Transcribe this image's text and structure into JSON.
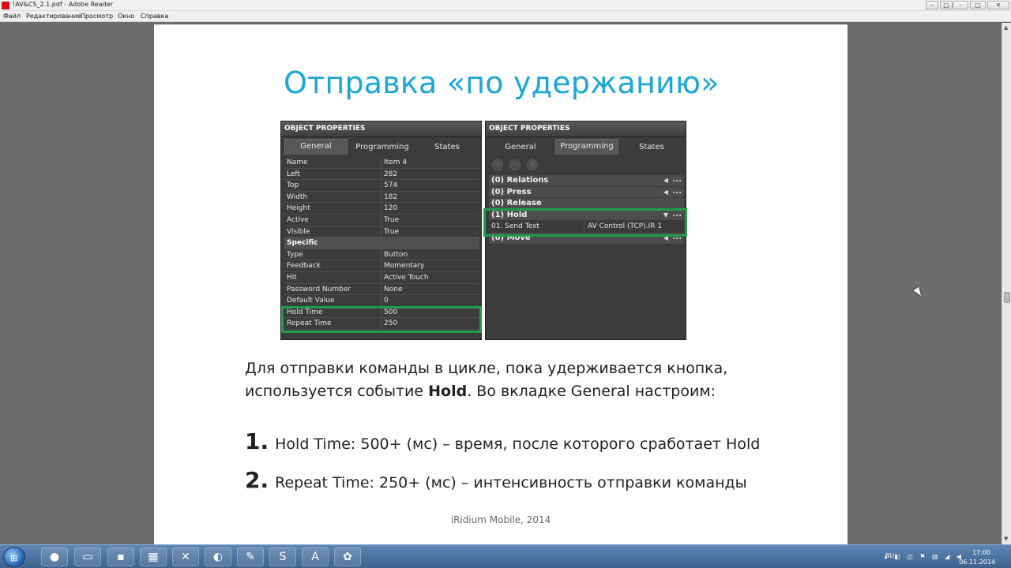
{
  "window": {
    "title": "!AV&CS_2.1.pdf - Adobe Reader",
    "minimize": "–",
    "maximize": "□",
    "close": "✕"
  },
  "menu": [
    "Файл",
    "Редактирование",
    "Просмотр",
    "Окно",
    "Справка"
  ],
  "slide": {
    "title": "Отправка «по удержанию»",
    "left_panel": {
      "header": "OBJECT PROPERTIES",
      "tabs": [
        "General",
        "Programming",
        "States"
      ],
      "active_tab": "General",
      "rows": [
        {
          "k": "Name",
          "v": "Item 4"
        },
        {
          "k": "Left",
          "v": "282"
        },
        {
          "k": "Top",
          "v": "574"
        },
        {
          "k": "Width",
          "v": "182"
        },
        {
          "k": "Height",
          "v": "120"
        },
        {
          "k": "Active",
          "v": "True"
        },
        {
          "k": "Visible",
          "v": "True"
        },
        {
          "k": "Specific",
          "v": ""
        },
        {
          "k": "Type",
          "v": "Button"
        },
        {
          "k": "Feedback",
          "v": "Momentary"
        },
        {
          "k": "Hit",
          "v": "Active Touch"
        },
        {
          "k": "Password Number",
          "v": "None"
        },
        {
          "k": "Default Value",
          "v": "0"
        },
        {
          "k": "Hold Time",
          "v": "500"
        },
        {
          "k": "Repeat Time",
          "v": "250"
        }
      ]
    },
    "right_panel": {
      "header": "OBJECT PROPERTIES",
      "tabs": [
        "General",
        "Programming",
        "States"
      ],
      "active_tab": "Programming",
      "events": {
        "relations": "(0) Relations",
        "press": "(0) Press",
        "release": "(0) Release",
        "hold": "(1) Hold",
        "move": "(0) Move"
      },
      "command": {
        "k": "01. Send Text",
        "v": "AV Control (TCP).IR 1"
      },
      "dots": "...",
      "arrow": "◀"
    },
    "paragraph_part1": "Для отправки команды в цикле, пока удерживается кнопка, используется  событие ",
    "paragraph_bold": "Hold",
    "paragraph_part2": ". Во вкладке General настроим:",
    "list": [
      {
        "num": "1.",
        "text": "Hold Time: 500+ (мс) – время, после которого сработает Hold"
      },
      {
        "num": "2.",
        "text": "Repeat Time: 250+ (мс) – интенсивность отправки команды"
      }
    ],
    "footer": "iRidium Mobile, 2014"
  },
  "taskbar": {
    "lang": "RU",
    "time": "17:00",
    "date": "06.11.2014"
  },
  "colors": {
    "title_blue": "#1ba7d6",
    "highlight_green": "#1f9d4b"
  }
}
